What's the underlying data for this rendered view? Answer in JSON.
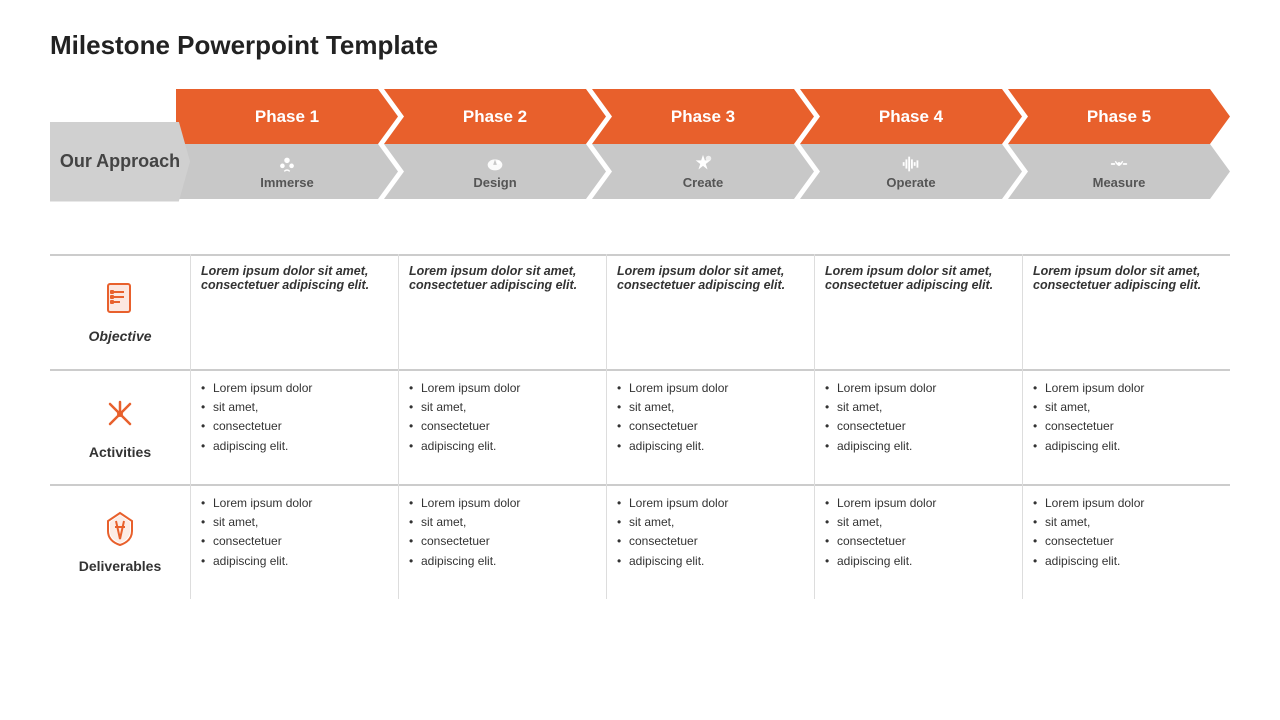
{
  "title": "Milestone Powerpoint Template",
  "approach_label": "Our Approach",
  "phases": [
    {
      "label": "Phase 1",
      "sublabel": "Immerse",
      "icon": "immerse"
    },
    {
      "label": "Phase 2",
      "sublabel": "Design",
      "icon": "design"
    },
    {
      "label": "Phase 3",
      "sublabel": "Create",
      "icon": "create"
    },
    {
      "label": "Phase 4",
      "sublabel": "Operate",
      "icon": "operate"
    },
    {
      "label": "Phase 5",
      "sublabel": "Measure",
      "icon": "measure"
    }
  ],
  "rows": [
    {
      "label": "Objective",
      "icon_type": "checklist",
      "italic": true,
      "cells": [
        "Lorem ipsum dolor sit amet, consectetuer adipiscing elit.",
        "Lorem ipsum dolor sit amet, consectetuer adipiscing elit.",
        "Lorem ipsum dolor sit amet, consectetuer adipiscing elit.",
        "Lorem ipsum dolor sit amet, consectetuer adipiscing elit.",
        "Lorem ipsum dolor sit amet, consectetuer adipiscing elit."
      ]
    },
    {
      "label": "Activities",
      "icon_type": "activities",
      "italic": false,
      "cells": [
        [
          "Lorem ipsum dolor",
          "sit amet,",
          "consectetuer",
          "adipiscing elit."
        ],
        [
          "Lorem ipsum dolor",
          "sit amet,",
          "consectetuer",
          "adipiscing elit."
        ],
        [
          "Lorem ipsum dolor",
          "sit amet,",
          "consectetuer",
          "adipiscing elit."
        ],
        [
          "Lorem ipsum dolor",
          "sit amet,",
          "consectetuer",
          "adipiscing elit."
        ],
        [
          "Lorem ipsum dolor",
          "sit amet,",
          "consectetuer",
          "adipiscing elit."
        ]
      ]
    },
    {
      "label": "Deliverables",
      "icon_type": "hourglass",
      "italic": false,
      "cells": [
        [
          "Lorem ipsum dolor",
          "sit amet,",
          "consectetuer",
          "adipiscing elit."
        ],
        [
          "Lorem ipsum dolor",
          "sit amet,",
          "consectetuer",
          "adipiscing elit."
        ],
        [
          "Lorem ipsum dolor",
          "sit amet,",
          "consectetuer",
          "adipiscing elit."
        ],
        [
          "Lorem ipsum dolor",
          "sit amet,",
          "consectetuer",
          "adipiscing elit."
        ],
        [
          "Lorem ipsum dolor",
          "sit amet,",
          "consectetuer",
          "adipiscing elit."
        ]
      ]
    }
  ],
  "colors": {
    "orange": "#E8602C",
    "gray": "#c8c8c8",
    "text_dark": "#222222"
  }
}
